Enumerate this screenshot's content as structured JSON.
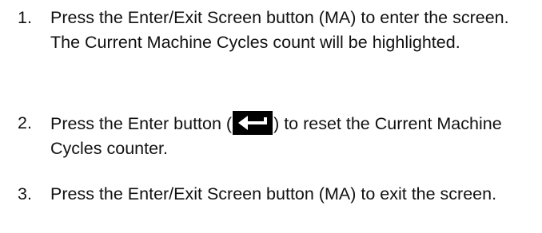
{
  "steps": [
    {
      "number": "1.",
      "text": "Press the Enter/Exit Screen button (MA) to enter the screen. The Current Machine Cycles count will be highlighted."
    },
    {
      "number": "2.",
      "text_before": "Press the Enter button (",
      "icon": "enter-key-icon",
      "text_after": ") to reset the Current Machine Cycles counter."
    },
    {
      "number": "3.",
      "text": "Press the Enter/Exit Screen button (MA) to exit the screen."
    }
  ]
}
